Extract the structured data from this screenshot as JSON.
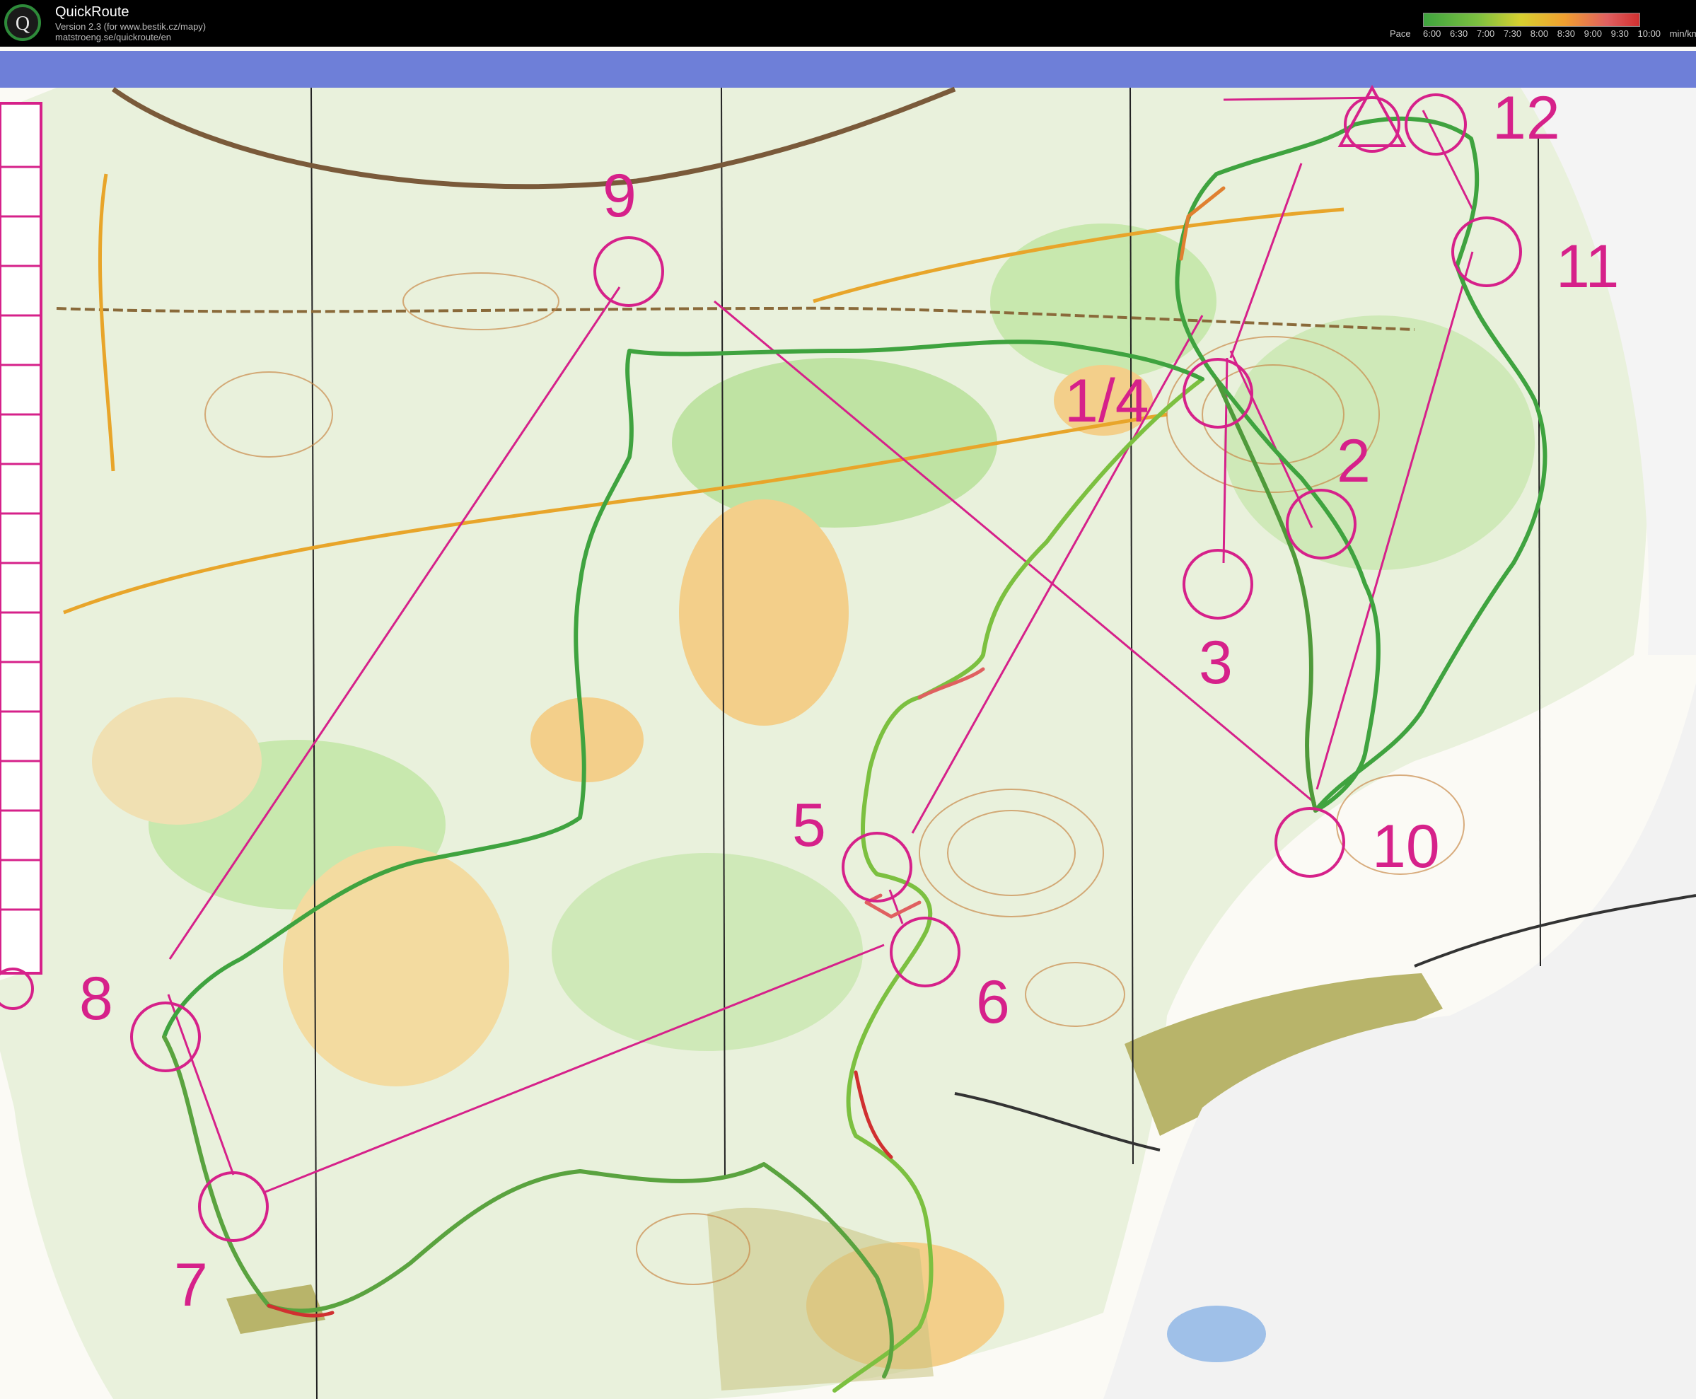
{
  "app": {
    "name": "QuickRoute",
    "version_line": "Version 2.3  (for www.bestik.cz/mapy)",
    "url_line": "matstroeng.se/quickroute/en",
    "logo_letter": "Q"
  },
  "pace_legend": {
    "label": "Pace",
    "ticks": [
      "6:00",
      "6:30",
      "7:00",
      "7:30",
      "8:00",
      "8:30",
      "9:00",
      "9:30",
      "10:00",
      "min/km"
    ]
  },
  "map": {
    "control_labels": [
      "1/4",
      "2",
      "3",
      "5",
      "6",
      "7",
      "8",
      "9",
      "10",
      "11",
      "12"
    ],
    "colors": {
      "course_line": "#d6218a",
      "route_fast": "#3fa33f",
      "route_slow": "#d03030",
      "open_land": "#f3cf8a",
      "forest_green": "#bfe3a3",
      "header_band": "#6e7fd8"
    }
  }
}
